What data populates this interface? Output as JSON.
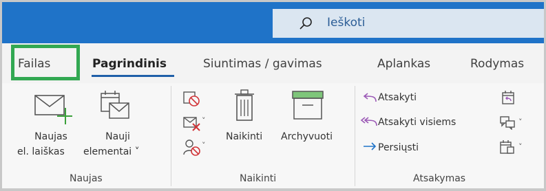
{
  "search": {
    "text": "Ieškoti",
    "icon": "search-icon"
  },
  "tabs": [
    {
      "label": "Failas"
    },
    {
      "label": "Pagrindinis"
    },
    {
      "label": "Siuntimas / gavimas"
    },
    {
      "label": "Aplankas"
    },
    {
      "label": "Rodymas"
    }
  ],
  "groups": {
    "naujas": {
      "label": "Naujas",
      "new_email_line1": "Naujas",
      "new_email_line2": "el. laiškas",
      "new_items_line1": "Nauji",
      "new_items_line2": "elementai ˅"
    },
    "naikinti": {
      "label": "Naikinti",
      "delete": "Naikinti",
      "archive": "Archyvuoti"
    },
    "atsakymas": {
      "label": "Atsakymas",
      "reply": "Atsakyti",
      "reply_all": "Atsakyti visiems",
      "forward": "Persiųsti"
    }
  },
  "colors": {
    "titlebar": "#1f73c8",
    "accent_underline": "#1f5fa8",
    "file_highlight": "#32a852",
    "reply_arrow": "#9b59b6",
    "forward_arrow": "#1f73c8",
    "delete_red": "#d13438",
    "archive_green": "#7ec57a"
  }
}
